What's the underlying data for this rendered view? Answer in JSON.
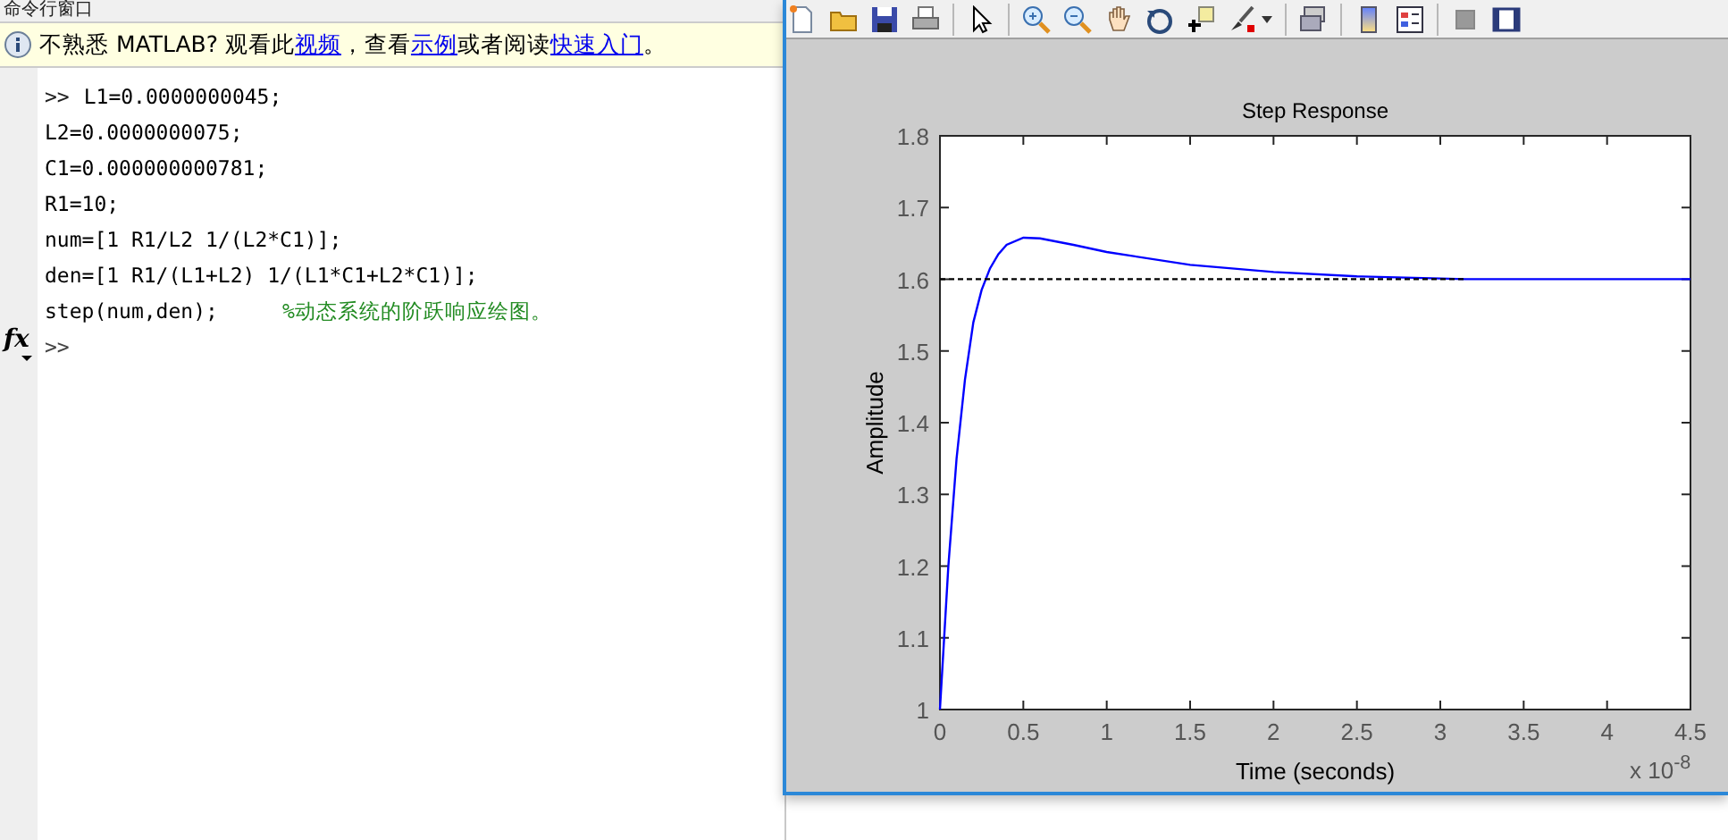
{
  "command_window": {
    "title": "命令行窗口",
    "info_bar": {
      "parts": [
        {
          "text": "不熟悉 MATLAB? 观看此",
          "link": false
        },
        {
          "text": "视频",
          "link": true
        },
        {
          "text": "，查看",
          "link": false
        },
        {
          "text": "示例",
          "link": true
        },
        {
          "text": "或者阅读",
          "link": false
        },
        {
          "text": "快速入门",
          "link": true
        },
        {
          "text": "。",
          "link": false
        }
      ]
    },
    "lines": [
      {
        "prompt": ">>",
        "code": "L1=0.0000000045;"
      },
      {
        "code": "L2=0.0000000075;"
      },
      {
        "code": "C1=0.000000000781;"
      },
      {
        "code": "R1=10;"
      },
      {
        "code": "num=[1 R1/L2 1/(L2*C1)];"
      },
      {
        "code": "den=[1 R1/(L1+L2) 1/(L1*C1+L2*C1)];"
      },
      {
        "code": "step(num,den);",
        "comment": "%动态系统的阶跃响应绘图。"
      }
    ],
    "function_button": "fx",
    "prompt": ">>"
  },
  "figure": {
    "chart_data": {
      "type": "line",
      "title": "Step Response",
      "xlabel": "Time (seconds)",
      "ylabel": "Amplitude",
      "x": [
        0,
        0.05,
        0.1,
        0.15,
        0.2,
        0.25,
        0.3,
        0.35,
        0.4,
        0.5,
        0.6,
        0.8,
        1,
        1.5,
        2,
        2.5,
        3,
        3.15,
        4.5
      ],
      "series": [
        {
          "color": "#0000ff",
          "line_style": "solid",
          "values": [
            1.0,
            1.2,
            1.35,
            1.46,
            1.54,
            1.585,
            1.615,
            1.635,
            1.648,
            1.658,
            1.657,
            1.648,
            1.638,
            1.62,
            1.61,
            1.604,
            1.601,
            1.6,
            1.6
          ]
        },
        {
          "color": "#000000",
          "line_style": "dashed",
          "values": [
            1.6,
            1.6,
            1.6,
            1.6,
            1.6,
            1.6,
            1.6,
            1.6,
            1.6,
            1.6,
            1.6,
            1.6,
            1.6,
            1.6,
            1.6,
            1.6,
            1.6,
            1.6,
            null
          ]
        }
      ],
      "xlim": [
        0,
        4.5
      ],
      "ylim": [
        1,
        1.8
      ],
      "xticks": [
        0,
        0.5,
        1,
        1.5,
        2,
        2.5,
        3,
        3.5,
        4,
        4.5
      ],
      "yticks": [
        1,
        1.1,
        1.2,
        1.3,
        1.4,
        1.5,
        1.6,
        1.7,
        1.8
      ]
    },
    "axis_multiplier": "x 10$^{-8}$"
  }
}
